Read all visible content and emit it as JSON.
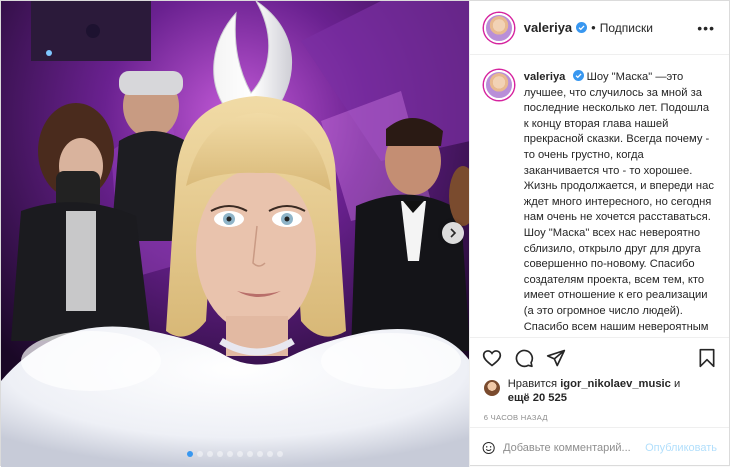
{
  "post": {
    "username": "valeriya",
    "verified": true,
    "header_separator": "•",
    "follow_label": "Подписки",
    "more_icon": "ellipsis-icon",
    "caption_text": " Шоу \"Маска\" —это лучшее, что случилось за мной за последние несколько лет. Подошла к концу вторая глава нашей прекрасной сказки. Всегда почему - то очень грустно, когда заканчивается что - то хорошее. Жизнь продолжается, и впереди нас ждет много интересного, но сегодня нам очень не хочется расставаться. Шоу \"Маска\" всех нас невероятно сблизило, открыло друг для друга совершенно по-новому. Спасибо создателям проекта, всем тем, кто имеет отношение к его реализации (а это огромное число людей). Спасибо всем нашим невероятным артистам, моим коллегам по жюри и вам, наши чудесные зрители, за",
    "likes_prefix": "Нравится ",
    "likes_user": "igor_nikolaev_music",
    "likes_middle": " и",
    "likes_more_prefix": "ещё ",
    "likes_count": "20 525",
    "time_ago": "6 часов назад",
    "comment_placeholder": "Добавьте комментарий...",
    "publish_label": "Опубликовать",
    "carousel_total": 10,
    "carousel_active": 1
  },
  "colors": {
    "accent_blue": "#3897f0",
    "publish_disabled": "#b2dffc",
    "muted": "#8e8e8e"
  }
}
